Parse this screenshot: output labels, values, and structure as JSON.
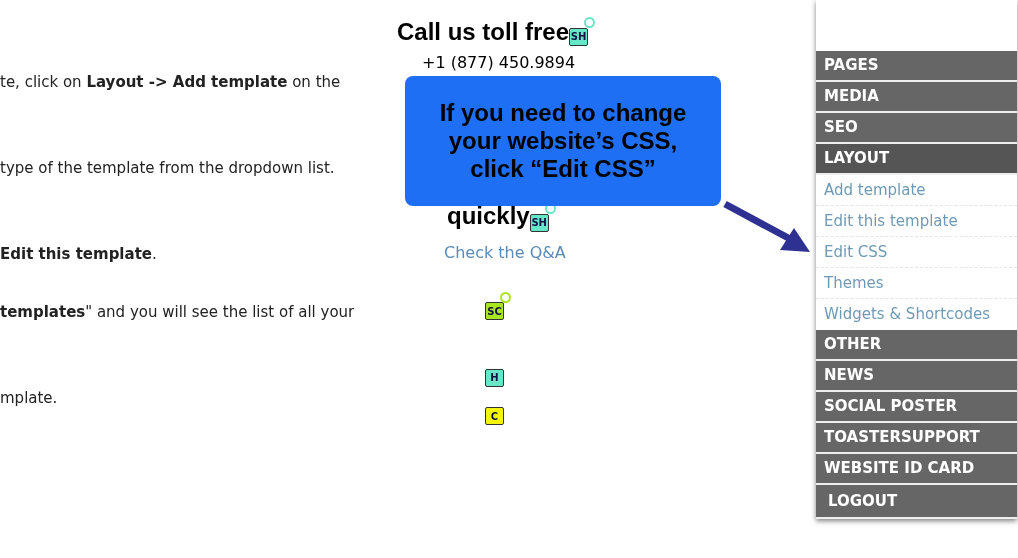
{
  "article_lines": [
    "te, click on **Layout -> Add template** on the",
    "type of the template from the dropdown list.",
    "**Edit this template**.",
    "**templates**\" and you will see the list of all your",
    "mplate."
  ],
  "contact": {
    "heading": "Call us toll free",
    "heading_badge": {
      "label": "SH",
      "color": "#66e8c8",
      "pin": true
    },
    "phone": "+1 (877) 450.9894"
  },
  "answers": {
    "heading": "quickly",
    "heading_badge": {
      "label": "SH",
      "color": "#66e8c8",
      "pin": true
    },
    "link": "Check the Q&A"
  },
  "badges": [
    {
      "label": "SC",
      "color": "#a8e61e",
      "pin": true
    },
    {
      "label": "H",
      "color": "#66e8c8",
      "pin": false
    },
    {
      "label": "C",
      "color": "#f5f50a",
      "pin": false
    }
  ],
  "callout": {
    "text": "If you need to change your website’s CSS, click “Edit CSS”"
  },
  "sidebar": {
    "items": [
      {
        "label": "PAGES",
        "kind": "section",
        "selected": false
      },
      {
        "label": "MEDIA",
        "kind": "section",
        "selected": false
      },
      {
        "label": "SEO",
        "kind": "section",
        "selected": false
      },
      {
        "label": "LAYOUT",
        "kind": "section",
        "selected": true,
        "children": [
          {
            "label": "Add template"
          },
          {
            "label": "Edit this template"
          },
          {
            "label": "Edit CSS"
          },
          {
            "label": "Themes"
          },
          {
            "label": "Widgets & Shortcodes"
          }
        ]
      },
      {
        "label": "OTHER",
        "kind": "section",
        "selected": false
      },
      {
        "label": "NEWS",
        "kind": "section",
        "selected": false
      },
      {
        "label": "SOCIAL POSTER",
        "kind": "section",
        "selected": false
      },
      {
        "label": "TOASTERSUPPORT",
        "kind": "section",
        "selected": false
      },
      {
        "label": "WEBSITE ID CARD",
        "kind": "section",
        "selected": false
      },
      {
        "label": "LOGOUT",
        "kind": "logout",
        "selected": false
      }
    ]
  }
}
